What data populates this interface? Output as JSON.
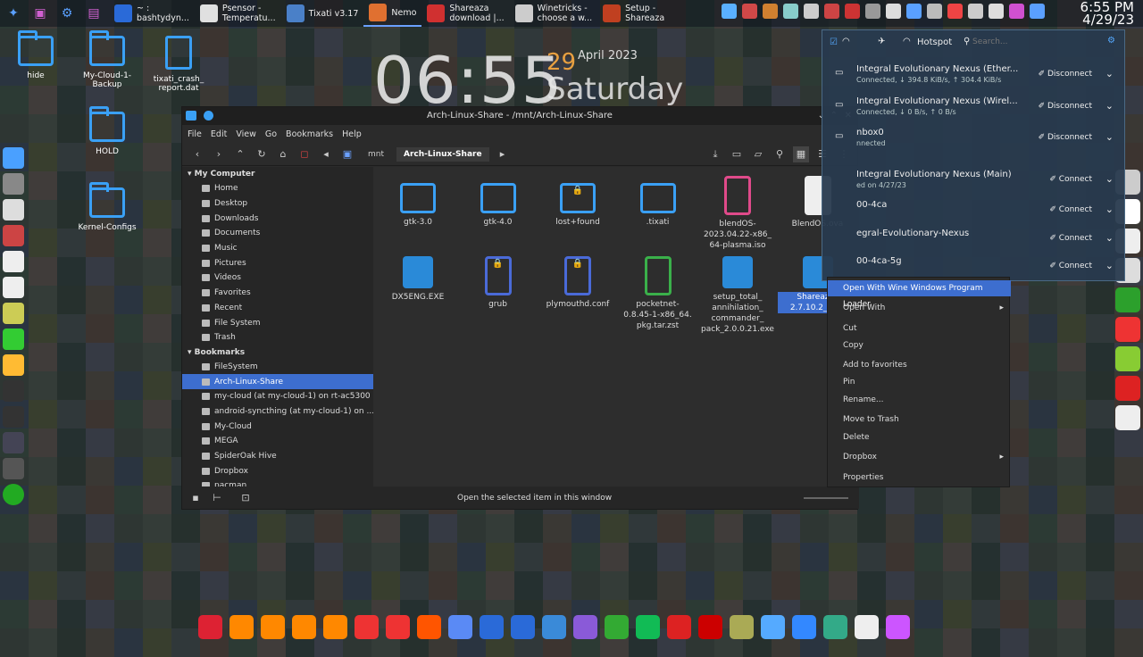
{
  "colors": {
    "accent": "#3d6ecf",
    "folder": "#3aa0f5"
  },
  "taskbar": {
    "tasks": [
      {
        "label": "~ :\nbashtydyn...",
        "color": "#2a6ad8"
      },
      {
        "label": "Psensor -\nTemperatu...",
        "color": "#e0e0e0"
      },
      {
        "label": "Tixati v3.17",
        "color": "#4a80c8"
      },
      {
        "label": "Nemo",
        "color": "#e07030"
      },
      {
        "label": "Shareaza\ndownload |...",
        "color": "#d03030"
      },
      {
        "label": "Winetricks -\nchoose a w...",
        "color": "#cccccc"
      },
      {
        "label": "Setup -\nShareaza",
        "color": "#c04020"
      }
    ],
    "clock_time": "6:55 PM",
    "clock_date": "4/29/23"
  },
  "desktop": {
    "icons": [
      {
        "label": "hide",
        "type": "folder"
      },
      {
        "label": "My-Cloud-1-\nBackup",
        "type": "folder"
      },
      {
        "label": "tixati_crash_\nreport.dat",
        "type": "file"
      },
      {
        "label": "HOLD",
        "type": "folder"
      },
      {
        "label": "Kernel-Configs",
        "type": "folder"
      }
    ],
    "bigclock": {
      "time": "06:55",
      "day": "29",
      "month": "April 2023",
      "weekday": "Saturday"
    }
  },
  "window": {
    "title": "Arch-Linux-Share - /mnt/Arch-Linux-Share",
    "menu": [
      "File",
      "Edit",
      "View",
      "Go",
      "Bookmarks",
      "Help"
    ],
    "path": [
      "mnt",
      "Arch-Linux-Share"
    ],
    "sidebar": {
      "sections": [
        {
          "header": "My Computer",
          "items": [
            "Home",
            "Desktop",
            "Downloads",
            "Documents",
            "Music",
            "Pictures",
            "Videos",
            "Favorites",
            "Recent",
            "File System",
            "Trash"
          ]
        },
        {
          "header": "Bookmarks",
          "items": [
            "FileSystem",
            "Arch-Linux-Share",
            "my-cloud (at my-cloud-1) on rt-ac5300",
            "android-syncthing (at my-cloud-1) on ...",
            "My-Cloud",
            "MEGA",
            "SpiderOak Hive",
            "Dropbox",
            "pacman"
          ]
        }
      ],
      "selected": "Arch-Linux-Share"
    },
    "files": [
      {
        "name": "gtk-3.0",
        "kind": "folder"
      },
      {
        "name": "gtk-4.0",
        "kind": "folder"
      },
      {
        "name": "lost+found",
        "kind": "folder-locked"
      },
      {
        "name": ".tixati",
        "kind": "folder"
      },
      {
        "name": "blendOS-\n2023.04.22-x86_\n64-plasma.iso",
        "kind": "iso"
      },
      {
        "name": "BlendOS.ova",
        "kind": "blank"
      },
      {
        "name": "DX5ENG.EXE",
        "kind": "exe"
      },
      {
        "name": "grub",
        "kind": "doc-locked"
      },
      {
        "name": "plymouthd.conf",
        "kind": "doc-locked"
      },
      {
        "name": "pocketnet-\n0.8.45-1-x86_64.\npkg.tar.zst",
        "kind": "archive"
      },
      {
        "name": "setup_total_\nannihilation_\ncommander_\npack_2.0.0.21.exe",
        "kind": "exe"
      },
      {
        "name": "Shareaza_\n2.7.10.2_x6...",
        "kind": "exe"
      }
    ],
    "status": "Open the selected item in this window"
  },
  "network": {
    "hotspot": "Hotspot",
    "search_placeholder": "Search...",
    "connections": [
      {
        "name": "Integral Evolutionary Nexus (Ether...",
        "sub": "Connected, ↓ 394.8 KiB/s, ↑ 304.4 KiB/s",
        "action": "Disconnect"
      },
      {
        "name": "Integral Evolutionary Nexus (Wirel...",
        "sub": "Connected, ↓ 0 B/s, ↑ 0 B/s",
        "action": "Disconnect"
      },
      {
        "name": "nbox0",
        "sub": "nnected",
        "action": "Disconnect"
      },
      {
        "name": "Integral Evolutionary Nexus (Main)",
        "sub": "ed on 4/27/23",
        "action": "Connect"
      },
      {
        "name": "00-4ca",
        "sub": "",
        "action": "Connect"
      },
      {
        "name": "egral-Evolutionary-Nexus",
        "sub": "",
        "action": "Connect"
      },
      {
        "name": "00-4ca-5g",
        "sub": "",
        "action": "Connect"
      }
    ]
  },
  "context_menu": [
    {
      "label": "Open With Wine Windows Program Loader",
      "hl": true
    },
    {
      "label": "Open With",
      "sub": true
    },
    {
      "label": "Cut"
    },
    {
      "label": "Copy"
    },
    {
      "label": "Add to favorites"
    },
    {
      "label": "Pin"
    },
    {
      "label": "Rename..."
    },
    {
      "label": "Move to Trash"
    },
    {
      "label": "Delete"
    },
    {
      "label": "Dropbox",
      "sub": true
    },
    {
      "label": "Properties"
    }
  ]
}
